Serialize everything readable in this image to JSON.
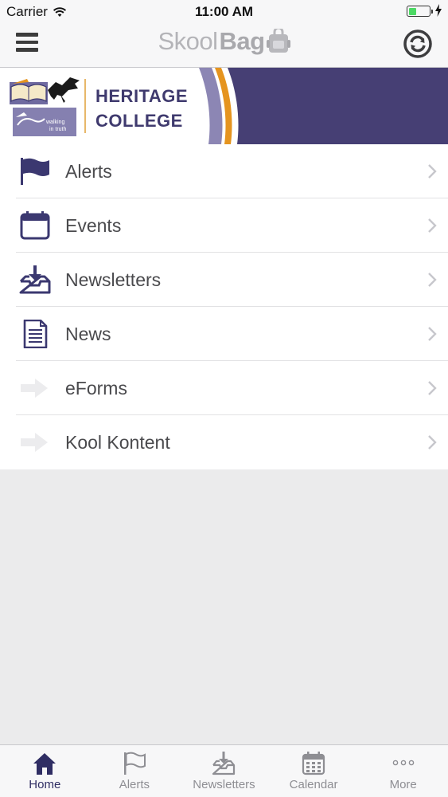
{
  "status_bar": {
    "carrier": "Carrier",
    "time": "11:00 AM",
    "battery_level": 0.35
  },
  "nav_bar": {
    "brand_part1": "Skool",
    "brand_part2": "Bag",
    "menu_icon": "hamburger-menu-icon",
    "sync_icon": "sync-icon"
  },
  "banner": {
    "title_line1": "HERITAGE",
    "title_line2": "COLLEGE",
    "logo_text_1": "walking",
    "logo_text_2": "in truth",
    "colors": {
      "navy": "#463f74",
      "orange": "#e5941f",
      "lavender": "#8c86b4",
      "title": "#3f3a6e"
    }
  },
  "menu": {
    "items": [
      {
        "label": "Alerts",
        "icon": "flag-icon"
      },
      {
        "label": "Events",
        "icon": "calendar-icon"
      },
      {
        "label": "Newsletters",
        "icon": "inbox-download-icon"
      },
      {
        "label": "News",
        "icon": "document-icon"
      },
      {
        "label": "eForms",
        "icon": "arrow-right-icon"
      },
      {
        "label": "Kool Kontent",
        "icon": "arrow-right-icon"
      }
    ]
  },
  "tab_bar": {
    "tabs": [
      {
        "label": "Home",
        "icon": "home-icon",
        "active": true
      },
      {
        "label": "Alerts",
        "icon": "flag-icon",
        "active": false
      },
      {
        "label": "Newsletters",
        "icon": "inbox-download-icon",
        "active": false
      },
      {
        "label": "Calendar",
        "icon": "calendar-icon",
        "active": false
      },
      {
        "label": "More",
        "icon": "more-dots-icon",
        "active": false
      }
    ]
  },
  "colors": {
    "accent": "#2f2d63",
    "icon": "#3b3870",
    "inactive": "#8e8e93",
    "background": "#ebebec"
  }
}
